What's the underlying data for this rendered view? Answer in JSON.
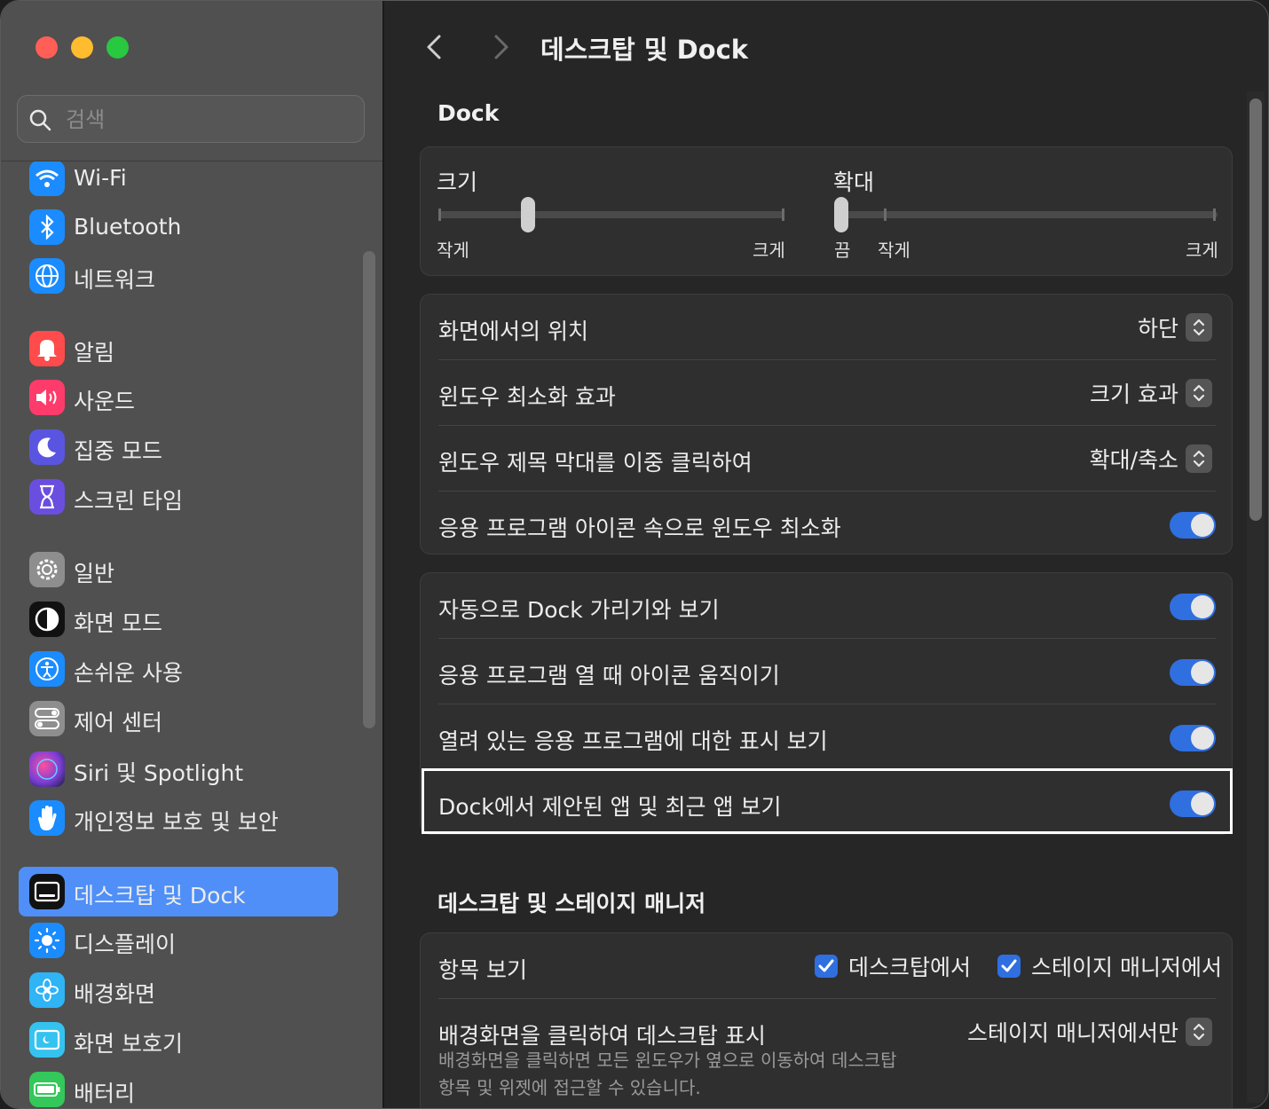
{
  "sidebar": {
    "search_placeholder": "검색",
    "items": [
      {
        "label": "Wi-Fi",
        "icon": "wifi-icon",
        "color": "#1a8cff"
      },
      {
        "label": "Bluetooth",
        "icon": "bluetooth-icon",
        "color": "#1a8cff"
      },
      {
        "label": "네트워크",
        "icon": "globe-icon",
        "color": "#1a8cff"
      },
      {
        "label": "알림",
        "icon": "bell-icon",
        "color": "#ff4b4b"
      },
      {
        "label": "사운드",
        "icon": "speaker-icon",
        "color": "#ff3b6b"
      },
      {
        "label": "집중 모드",
        "icon": "moon-icon",
        "color": "#5a55e0"
      },
      {
        "label": "스크린 타임",
        "icon": "hourglass-icon",
        "color": "#6a4ee0"
      },
      {
        "label": "일반",
        "icon": "gear-icon",
        "color": "#8e8e8e"
      },
      {
        "label": "화면 모드",
        "icon": "appearance-icon",
        "color": "#111111"
      },
      {
        "label": "손쉬운 사용",
        "icon": "accessibility-icon",
        "color": "#1a8cff"
      },
      {
        "label": "제어 센터",
        "icon": "control-center-icon",
        "color": "#8e8e8e"
      },
      {
        "label": "Siri 및 Spotlight",
        "icon": "siri-icon",
        "color": "#7a3fd6"
      },
      {
        "label": "개인정보 보호 및 보안",
        "icon": "hand-icon",
        "color": "#1a8cff"
      },
      {
        "label": "데스크탑 및 Dock",
        "icon": "dock-icon",
        "color": "#111111",
        "selected": true
      },
      {
        "label": "디스플레이",
        "icon": "sun-icon",
        "color": "#1a8cff"
      },
      {
        "label": "배경화면",
        "icon": "flower-icon",
        "color": "#2fb4f5"
      },
      {
        "label": "화면 보호기",
        "icon": "screensaver-icon",
        "color": "#34c3f0"
      },
      {
        "label": "배터리",
        "icon": "battery-icon",
        "color": "#34c759"
      }
    ]
  },
  "header": {
    "title": "데스크탑 및 Dock"
  },
  "dock": {
    "section_title": "Dock",
    "size": {
      "label": "크기",
      "min_label": "작게",
      "max_label": "크게",
      "value": 0.26
    },
    "magnification": {
      "label": "확대",
      "off_label": "끔",
      "min_label": "작게",
      "max_label": "크게",
      "value": 0.0
    },
    "position": {
      "label": "화면에서의 위치",
      "value": "하단"
    },
    "minimize_effect": {
      "label": "윈도우 최소화 효과",
      "value": "크기 효과"
    },
    "double_click": {
      "label": "윈도우 제목 막대를 이중 클릭하여",
      "value": "확대/축소"
    },
    "minimize_into_icon": {
      "label": "응용 프로그램 아이콘 속으로 윈도우 최소화",
      "on": true
    },
    "autohide": {
      "label": "자동으로 Dock 가리기와 보기",
      "on": true
    },
    "animate": {
      "label": "응용 프로그램 열 때 아이콘 움직이기",
      "on": true
    },
    "indicators": {
      "label": "열려 있는 응용 프로그램에 대한 표시 보기",
      "on": true
    },
    "suggested": {
      "label": "Dock에서 제안된 앱 및 최근 앱 보기",
      "on": true
    }
  },
  "stage": {
    "section_title": "데스크탑 및 스테이지 매니저",
    "show_items": {
      "label": "항목 보기",
      "desktop": "데스크탑에서",
      "stage_manager": "스테이지 매니저에서"
    },
    "click_wallpaper": {
      "label": "배경화면을 클릭하여 데스크탑 표시",
      "value": "스테이지 매니저에서만",
      "desc_line1": "배경화면을 클릭하면 모든 윈도우가 옆으로 이동하여 데스크탑",
      "desc_line2": "항목 및 위젯에 접근할 수 있습니다."
    }
  },
  "colors": {
    "accent": "#2f6fe0",
    "selected": "#4f8ff7"
  }
}
